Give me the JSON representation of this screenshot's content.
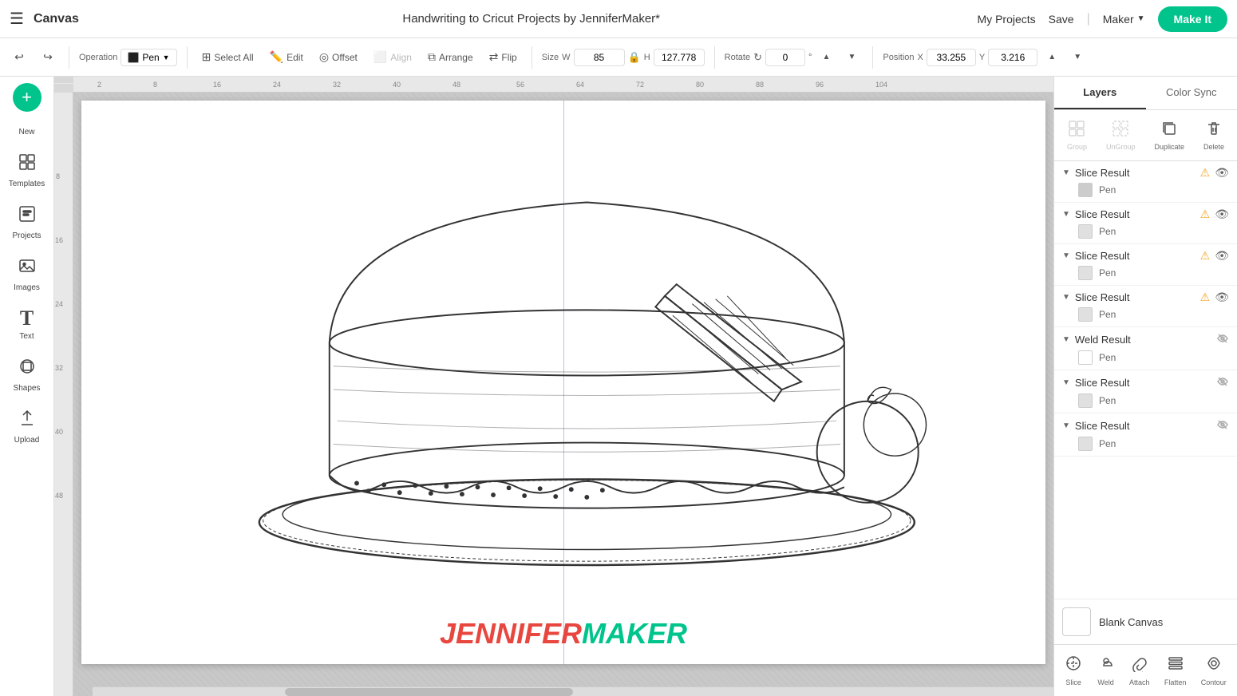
{
  "topbar": {
    "hamburger": "☰",
    "logo": "Canvas",
    "title": "Handwriting to Cricut Projects by JenniferMaker*",
    "my_projects": "My Projects",
    "save": "Save",
    "divider": "|",
    "maker": "Maker",
    "make_it": "Make It"
  },
  "toolbar": {
    "undo_label": "↩",
    "redo_label": "↪",
    "operation_label": "Operation",
    "op_value": "Pen",
    "select_all_label": "Select All",
    "edit_label": "Edit",
    "offset_label": "Offset",
    "align_label": "Align",
    "arrange_label": "Arrange",
    "flip_label": "Flip",
    "size_label": "Size",
    "w_label": "W",
    "w_value": "85",
    "h_label": "H",
    "h_value": "127.778",
    "lock_icon": "🔒",
    "rotate_label": "Rotate",
    "rotate_value": "0",
    "position_label": "Position",
    "x_label": "X",
    "x_value": "33.255",
    "y_label": "Y",
    "y_value": "3.216"
  },
  "sidebar": {
    "new_icon": "+",
    "new_label": "New",
    "templates_icon": "▦",
    "templates_label": "Templates",
    "projects_icon": "□",
    "projects_label": "Projects",
    "images_icon": "🖼",
    "images_label": "Images",
    "text_icon": "T",
    "text_label": "Text",
    "shapes_icon": "◎",
    "shapes_label": "Shapes",
    "upload_icon": "⬆",
    "upload_label": "Upload"
  },
  "right_panel": {
    "tab_layers": "Layers",
    "tab_color_sync": "Color Sync",
    "group_label": "Group",
    "ungroup_label": "UnGroup",
    "duplicate_label": "Duplicate",
    "delete_label": "Delete",
    "layers": [
      {
        "title": "Slice Result",
        "has_warning": true,
        "visible": true,
        "sub_label": "Pen",
        "color": "gray"
      },
      {
        "title": "Slice Result",
        "has_warning": true,
        "visible": true,
        "sub_label": "Pen",
        "color": "lightgray"
      },
      {
        "title": "Slice Result",
        "has_warning": true,
        "visible": true,
        "sub_label": "Pen",
        "color": "lightgray"
      },
      {
        "title": "Slice Result",
        "has_warning": true,
        "visible": true,
        "sub_label": "Pen",
        "color": "lightgray"
      },
      {
        "title": "Weld Result",
        "has_warning": false,
        "visible": false,
        "sub_label": "Pen",
        "color": "white"
      },
      {
        "title": "Slice Result",
        "has_warning": false,
        "visible": false,
        "sub_label": "Pen",
        "color": "lightgray"
      },
      {
        "title": "Slice Result",
        "has_warning": false,
        "visible": false,
        "sub_label": "Pen",
        "color": "lightgray"
      }
    ],
    "blank_canvas_label": "Blank Canvas",
    "bottom_tools": {
      "slice_label": "Slice",
      "weld_label": "Weld",
      "attach_label": "Attach",
      "flatten_label": "Flatten",
      "contour_label": "Contour"
    }
  },
  "canvas": {
    "jennifer_text": "JENNIFER",
    "maker_text": "MAKER",
    "ruler_marks_top": [
      "2",
      "8",
      "16",
      "24",
      "32",
      "40",
      "48",
      "56",
      "64",
      "72",
      "80",
      "88",
      "96",
      "104"
    ],
    "ruler_marks_left": [
      "8",
      "16",
      "24",
      "32",
      "40",
      "48"
    ]
  }
}
